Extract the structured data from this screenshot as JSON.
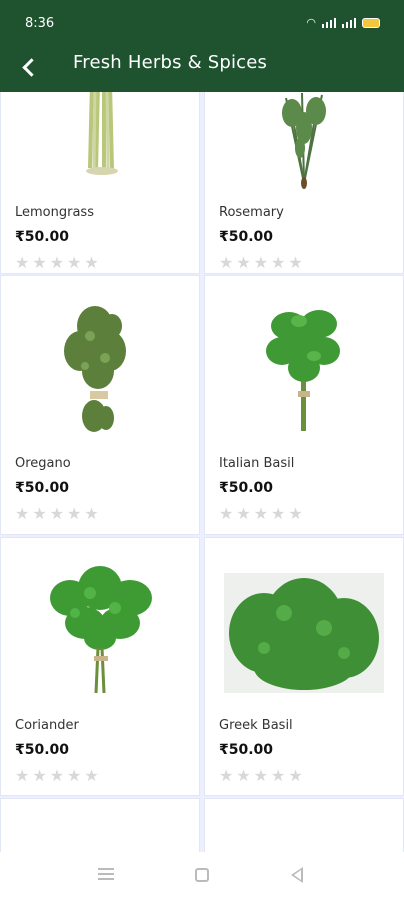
{
  "status_bar": {
    "time": "8:36"
  },
  "app_bar": {
    "title": "Fresh Herbs & Spices"
  },
  "products": [
    {
      "name": "Lemongrass",
      "price": "₹50.00",
      "rating": 0
    },
    {
      "name": "Rosemary",
      "price": "₹50.00",
      "rating": 0
    },
    {
      "name": "Oregano",
      "price": "₹50.00",
      "rating": 0
    },
    {
      "name": "Italian Basil",
      "price": "₹50.00",
      "rating": 0
    },
    {
      "name": "Coriander",
      "price": "₹50.00",
      "rating": 0
    },
    {
      "name": "Greek Basil",
      "price": "₹50.00",
      "rating": 0
    }
  ],
  "colors": {
    "header": "#1f5330",
    "star_empty": "#d8d8d8"
  }
}
